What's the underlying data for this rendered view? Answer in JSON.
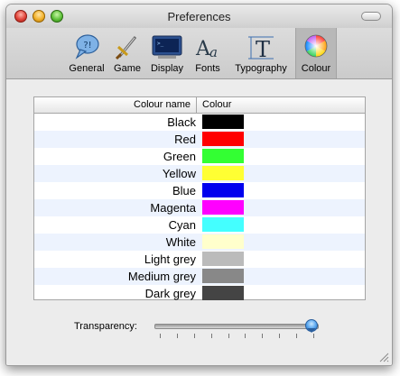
{
  "window": {
    "title": "Preferences"
  },
  "toolbar": {
    "items": [
      {
        "label": "General",
        "icon": "speech-bubble-icon"
      },
      {
        "label": "Game",
        "icon": "sword-icon"
      },
      {
        "label": "Display",
        "icon": "monitor-icon"
      },
      {
        "label": "Fonts",
        "icon": "font-aa-icon"
      },
      {
        "label": "Typography",
        "icon": "typography-t-icon"
      },
      {
        "label": "Colour",
        "icon": "color-wheel-icon",
        "selected": true
      }
    ]
  },
  "table": {
    "headers": {
      "name": "Colour name",
      "colour": "Colour"
    },
    "rows": [
      {
        "name": "Black",
        "color": "#000000"
      },
      {
        "name": "Red",
        "color": "#ff0000"
      },
      {
        "name": "Green",
        "color": "#33ff33"
      },
      {
        "name": "Yellow",
        "color": "#ffff33"
      },
      {
        "name": "Blue",
        "color": "#0000ee"
      },
      {
        "name": "Magenta",
        "color": "#ff00ff"
      },
      {
        "name": "Cyan",
        "color": "#44ffff"
      },
      {
        "name": "White",
        "color": "#ffffcc"
      },
      {
        "name": "Light grey",
        "color": "#bbbbbb"
      },
      {
        "name": "Medium grey",
        "color": "#888888"
      },
      {
        "name": "Dark grey",
        "color": "#444444"
      }
    ]
  },
  "transparency": {
    "label": "Transparency:",
    "value": 0.98
  }
}
